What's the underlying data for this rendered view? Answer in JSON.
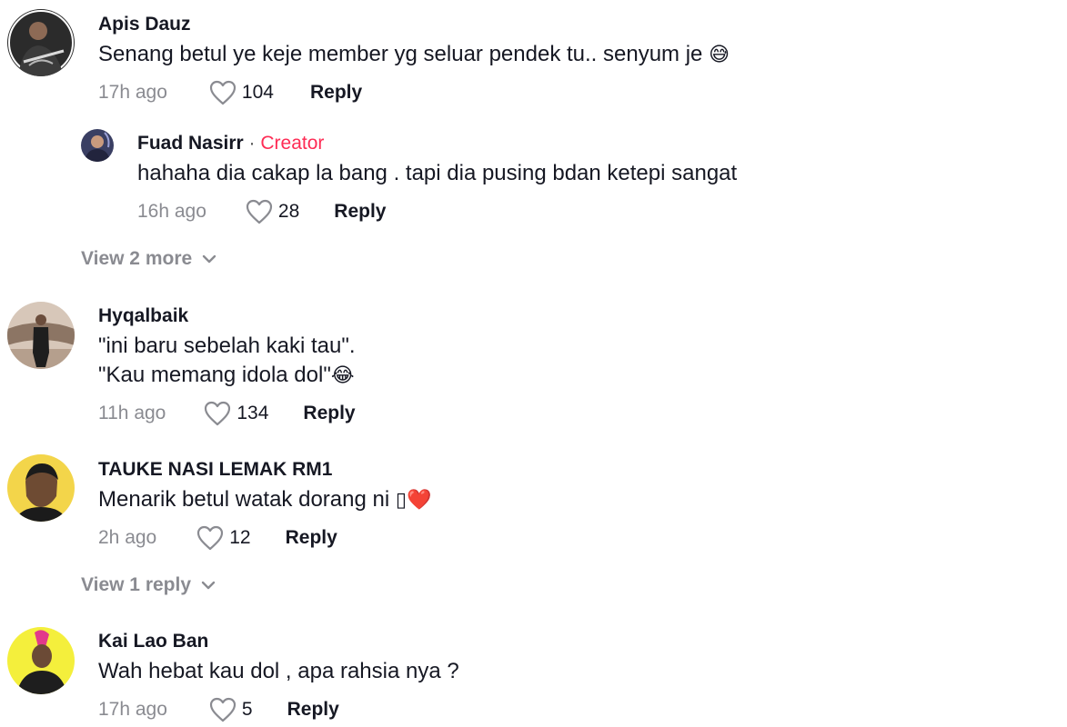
{
  "comments": [
    {
      "username": "Apis Dauz",
      "lines": [
        "Senang betul ye keje member yg seluar pendek tu.. senyum je"
      ],
      "emoji": "😅",
      "time": "17h ago",
      "likes": "104",
      "reply": "Reply",
      "avatar_icon": "user-avatar-guitarist"
    },
    {
      "username": "Fuad Nasirr",
      "separator": "·",
      "creator_badge": "Creator",
      "lines": [
        "hahaha dia cakap la bang . tapi dia pusing bdan ketepi sangat"
      ],
      "time": "16h ago",
      "likes": "28",
      "reply": "Reply",
      "avatar_icon": "user-avatar-creator"
    },
    {
      "username": "Hyqalbaik",
      "lines": [
        "\"ini baru sebelah kaki tau\".",
        "\"Kau memang idola dol\""
      ],
      "emoji": "😂",
      "time": "11h ago",
      "likes": "134",
      "reply": "Reply",
      "avatar_icon": "user-avatar-suit"
    },
    {
      "username": "TAUKE NASI LEMAK RM1",
      "lines": [
        "Menarik betul watak dorang ni"
      ],
      "emoji": "▯❤️",
      "time": "2h ago",
      "likes": "12",
      "reply": "Reply",
      "avatar_icon": "user-avatar-yellow"
    },
    {
      "username": "Kai Lao Ban",
      "lines": [
        "Wah hebat kau dol , apa rahsia nya ?"
      ],
      "time": "17h ago",
      "likes": "5",
      "reply": "Reply",
      "avatar_icon": "user-avatar-mohawk"
    }
  ],
  "view_more": [
    {
      "label": "View 2 more"
    },
    {
      "label": "View 1 reply"
    }
  ],
  "colors": {
    "text": "#161823",
    "muted": "#8a8b91",
    "creator": "#fe2c55",
    "background": "#ffffff"
  }
}
